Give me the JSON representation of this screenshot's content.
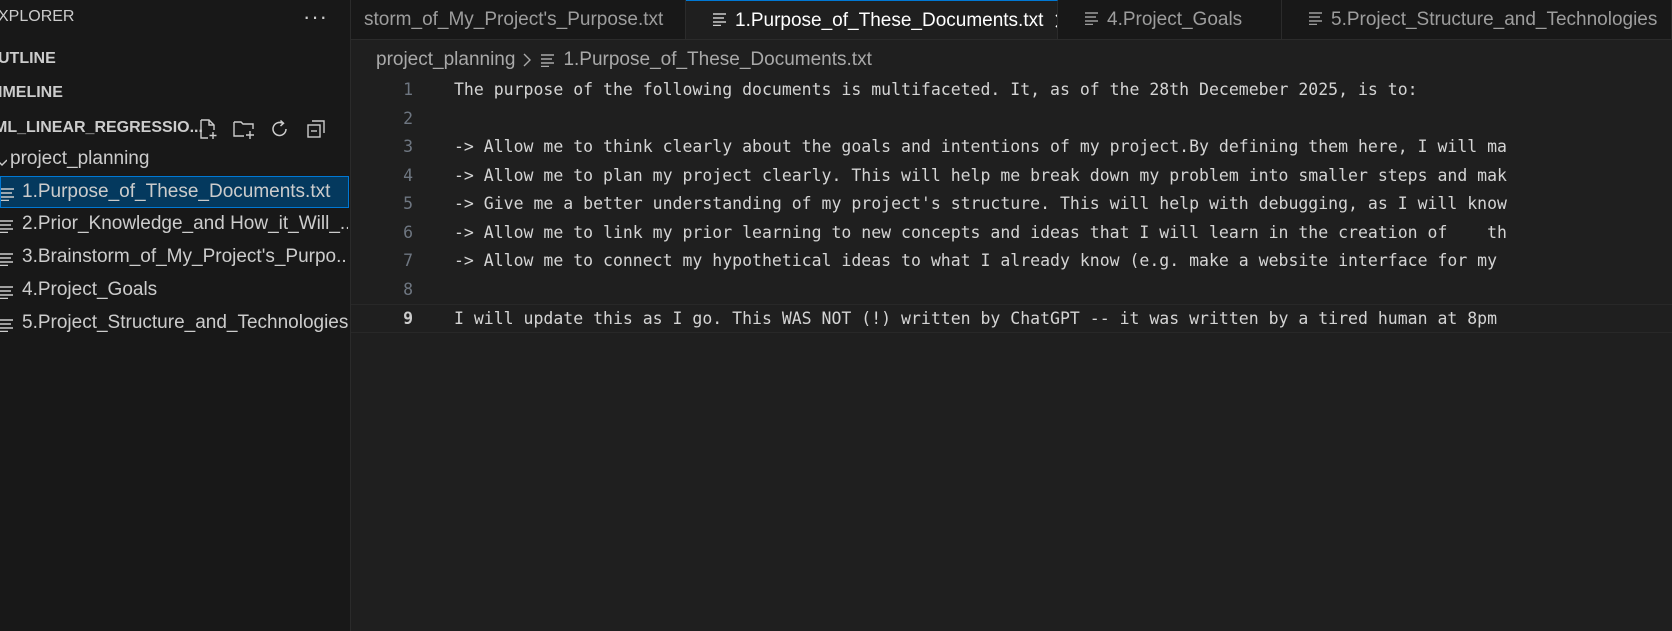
{
  "sidebar": {
    "title": "XPLORER",
    "more_actions": "···",
    "outline_label": "UTLINE",
    "timeline_label": "IMELINE",
    "project_name": "ML_LINEAR_REGRESSIO...",
    "folder": "project_planning",
    "files": [
      "1.Purpose_of_These_Documents.txt",
      "2.Prior_Knowledge_and How_it_Will_...",
      "3.Brainstorm_of_My_Project's_Purpo...",
      "4.Project_Goals",
      "5.Project_Structure_and_Technologies"
    ],
    "selected_index": 0
  },
  "tabs": [
    {
      "label": "storm_of_My_Project's_Purpose.txt",
      "active": false
    },
    {
      "label": "1.Purpose_of_These_Documents.txt",
      "active": true
    },
    {
      "label": "4.Project_Goals",
      "active": false
    },
    {
      "label": "5.Project_Structure_and_Technologies",
      "active": false
    }
  ],
  "breadcrumb": {
    "folder": "project_planning",
    "file": "1.Purpose_of_These_Documents.txt"
  },
  "editor": {
    "current_line": 9,
    "lines": [
      {
        "number": "1",
        "text": "The purpose of the following documents is multifaceted. It, as of the 28th Decemeber 2025, is to:"
      },
      {
        "number": "2",
        "text": ""
      },
      {
        "number": "3",
        "text": "-> Allow me to think clearly about the goals and intentions of my project.By defining them here, I will ma"
      },
      {
        "number": "4",
        "text": "-> Allow me to plan my project clearly. This will help me break down my problem into smaller steps and mak"
      },
      {
        "number": "5",
        "text": "-> Give me a better understanding of my project's structure. This will help with debugging, as I will know"
      },
      {
        "number": "6",
        "text": "-> Allow me to link my prior learning to new concepts and ideas that I will learn in the creation of    th"
      },
      {
        "number": "7",
        "text": "-> Allow me to connect my hypothetical ideas to what I already know (e.g. make a website interface for my"
      },
      {
        "number": "8",
        "text": ""
      },
      {
        "number": "9",
        "text": "I will update this as I go. This WAS NOT (!) written by ChatGPT -- it was written by a tired human at 8pm"
      }
    ]
  },
  "colors": {
    "sidebar_bg": "#181818",
    "editor_bg": "#1f1f1f",
    "selection_bg": "#04395e",
    "accent": "#0078d4"
  }
}
